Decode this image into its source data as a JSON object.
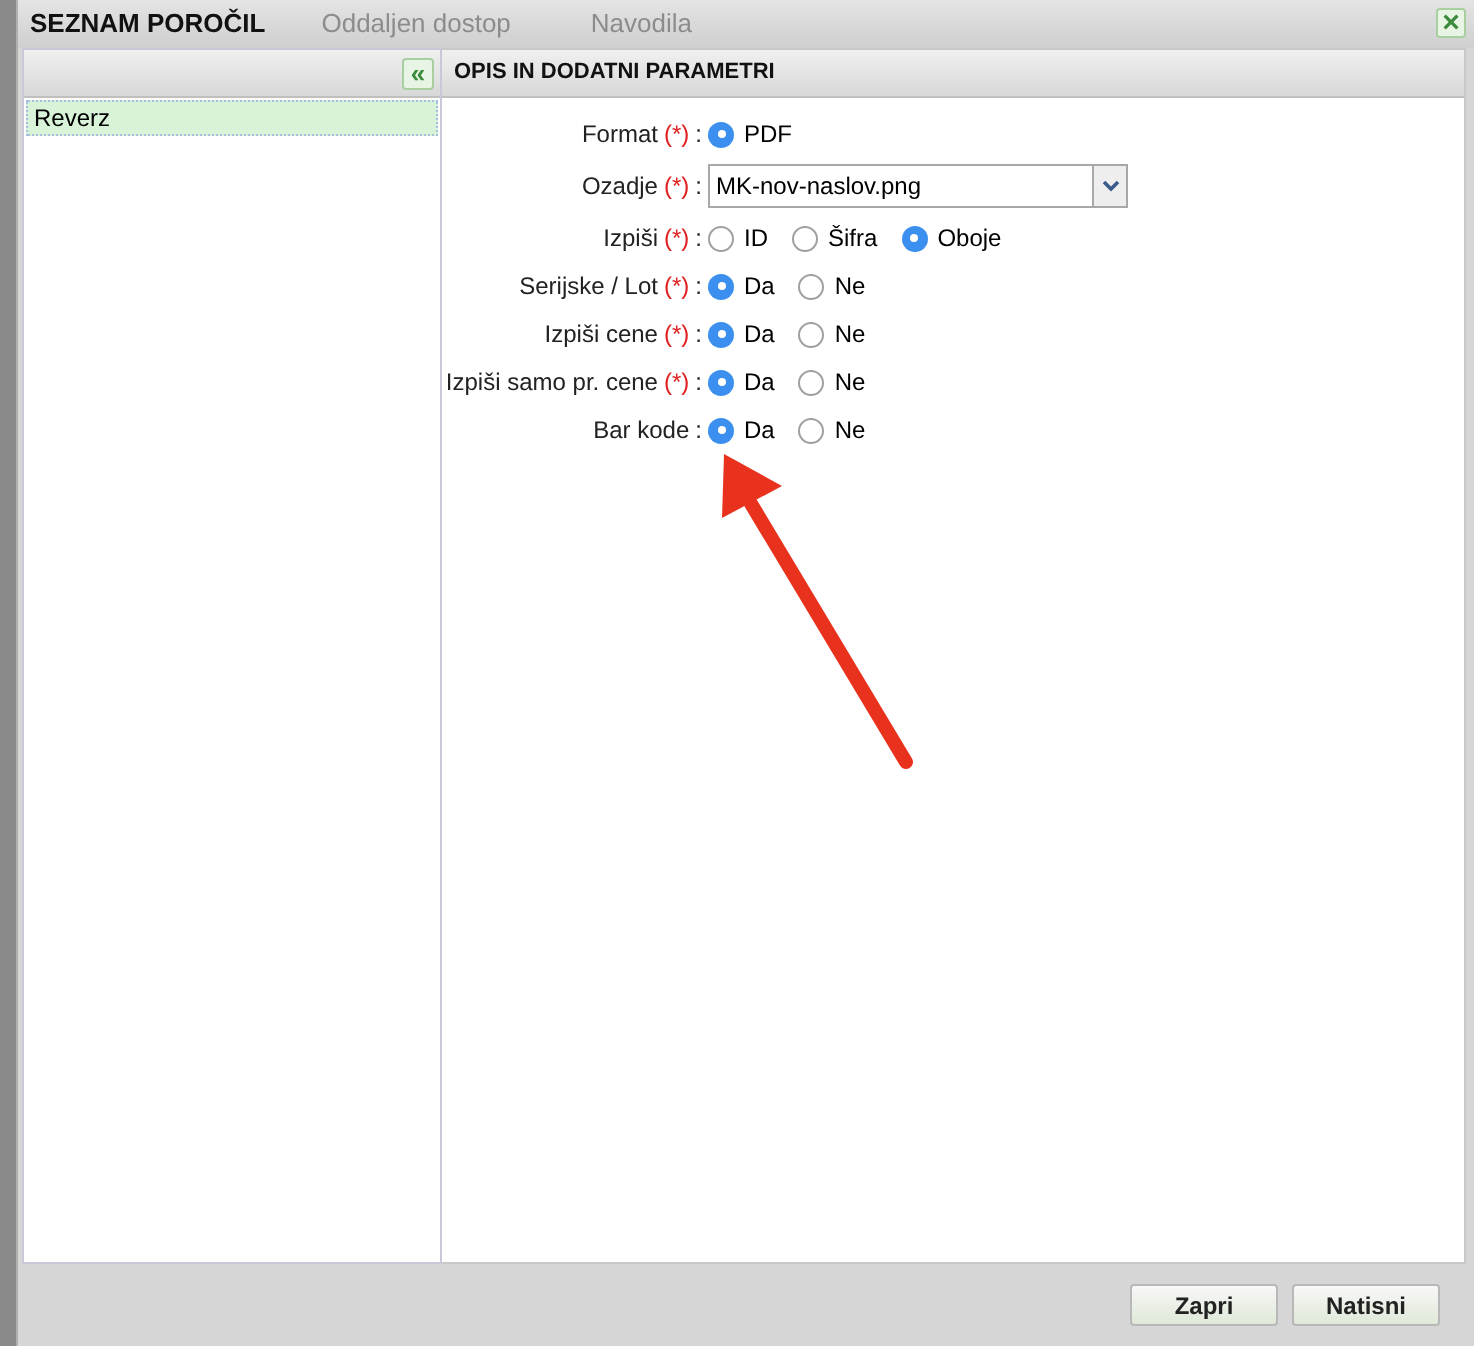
{
  "background": {
    "texts": [
      "Oddaljen dostop",
      "Navodila"
    ]
  },
  "window": {
    "title": "SEZNAM POROČIL",
    "close": "×"
  },
  "sidebar": {
    "collapse": "«",
    "items": [
      {
        "label": "Reverz",
        "selected": true
      }
    ]
  },
  "panel": {
    "title": "OPIS IN DODATNI PARAMETRI",
    "rows": [
      {
        "kind": "radio",
        "label": "Format",
        "required_mark": "(*)",
        "colon": ":",
        "options": [
          {
            "label": "PDF",
            "selected": true
          }
        ]
      },
      {
        "kind": "select",
        "label": "Ozadje",
        "required_mark": "(*)",
        "colon": ":",
        "value": "MK-nov-naslov.png"
      },
      {
        "kind": "radio",
        "label": "Izpiši",
        "required_mark": "(*)",
        "colon": ":",
        "options": [
          {
            "label": "ID",
            "selected": false
          },
          {
            "label": "Šifra",
            "selected": false
          },
          {
            "label": "Oboje",
            "selected": true
          }
        ]
      },
      {
        "kind": "radio",
        "label": "Serijske / Lot",
        "required_mark": "(*)",
        "colon": ":",
        "options": [
          {
            "label": "Da",
            "selected": true
          },
          {
            "label": "Ne",
            "selected": false
          }
        ]
      },
      {
        "kind": "radio",
        "label": "Izpiši cene",
        "required_mark": "(*)",
        "colon": ":",
        "options": [
          {
            "label": "Da",
            "selected": true
          },
          {
            "label": "Ne",
            "selected": false
          }
        ]
      },
      {
        "kind": "radio",
        "label": "Izpiši samo pr. cene",
        "required_mark": "(*)",
        "colon": ":",
        "options": [
          {
            "label": "Da",
            "selected": true
          },
          {
            "label": "Ne",
            "selected": false
          }
        ]
      },
      {
        "kind": "radio",
        "label": "Bar kode",
        "colon": ":",
        "options": [
          {
            "label": "Da",
            "selected": true
          },
          {
            "label": "Ne",
            "selected": false
          }
        ]
      }
    ]
  },
  "buttons": [
    "Zapri",
    "Natisni"
  ]
}
